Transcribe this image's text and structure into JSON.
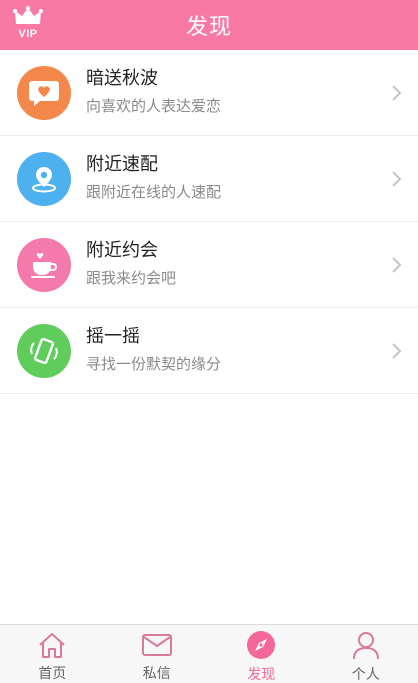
{
  "header": {
    "title": "发现",
    "vip_label": "VIP"
  },
  "colors": {
    "header_bg": "#f87aa4",
    "accent": "#f3679a",
    "icon_orange": "#f4874a",
    "icon_blue": "#4cb1ee",
    "icon_pink": "#f47aae",
    "icon_green": "#5fcc5c"
  },
  "list": {
    "items": [
      {
        "title": "暗送秋波",
        "subtitle": "向喜欢的人表达爱恋",
        "icon": "heart-chat-icon"
      },
      {
        "title": "附近速配",
        "subtitle": "跟附近在线的人速配",
        "icon": "location-pin-icon"
      },
      {
        "title": "附近约会",
        "subtitle": "跟我来约会吧",
        "icon": "coffee-cup-icon"
      },
      {
        "title": "摇一摇",
        "subtitle": "寻找一份默契的缘分",
        "icon": "shake-phone-icon"
      }
    ]
  },
  "tabbar": {
    "tabs": [
      {
        "label": "首页",
        "icon": "home-icon"
      },
      {
        "label": "私信",
        "icon": "mail-icon"
      },
      {
        "label": "发现",
        "icon": "compass-icon",
        "active": true
      },
      {
        "label": "个人",
        "icon": "person-icon"
      }
    ]
  }
}
